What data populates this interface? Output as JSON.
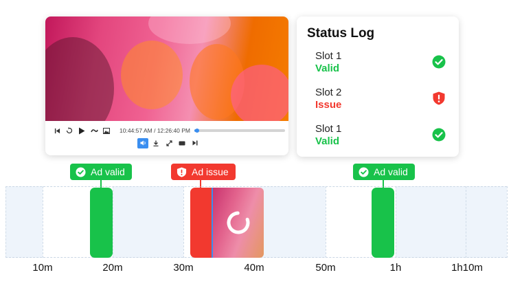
{
  "player": {
    "timecode": "10:44:57 AM / 12:26:40 PM",
    "progress_fraction": 0.03,
    "controls": [
      "skip-back-icon",
      "replay-icon",
      "play-icon",
      "speed-icon",
      "image-icon"
    ],
    "tools": [
      "volume-icon",
      "download-icon",
      "fullscreen-icon",
      "caption-icon",
      "skip-next-icon"
    ]
  },
  "status_log": {
    "title": "Status Log",
    "items": [
      {
        "slot": "Slot 1",
        "state": "Valid",
        "kind": "valid"
      },
      {
        "slot": "Slot 2",
        "state": "Issue",
        "kind": "issue"
      },
      {
        "slot": "Slot 1",
        "state": "Valid",
        "kind": "valid"
      }
    ]
  },
  "tags": [
    {
      "label": "Ad valid",
      "kind": "valid"
    },
    {
      "label": "Ad issue",
      "kind": "issue"
    },
    {
      "label": "Ad valid",
      "kind": "valid"
    }
  ],
  "axis_ticks": [
    "10m",
    "20m",
    "30m",
    "40m",
    "50m",
    "1h",
    "1h10m"
  ],
  "colors": {
    "valid": "#18c24a",
    "issue": "#f2392f",
    "accent": "#3a8ef0",
    "timeline_band": "#eef4fb"
  }
}
